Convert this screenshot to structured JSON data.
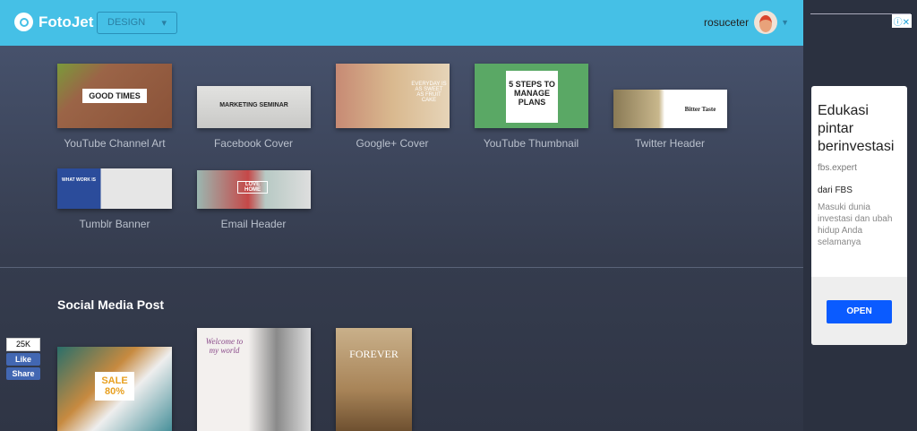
{
  "header": {
    "logo": "FotoJet",
    "mode": "DESIGN",
    "username": "rosuceter"
  },
  "templates": [
    {
      "label": "YouTube Channel Art",
      "text": "GOOD TIMES"
    },
    {
      "label": "Facebook Cover",
      "text": "MARKETING SEMINAR"
    },
    {
      "label": "Google+ Cover",
      "text": "EVERYDAY IS AS SWEET AS FRUIT CAKE"
    },
    {
      "label": "YouTube Thumbnail",
      "text": "5 STEPS TO MANAGE PLANS"
    },
    {
      "label": "Twitter Header",
      "text": "Bitter Taste"
    },
    {
      "label": "Tumblr Banner",
      "text": "WHAT WORK IS"
    },
    {
      "label": "Email Header",
      "text": "LOVE HOME"
    }
  ],
  "social": {
    "title": "Social Media Post",
    "posts": [
      {
        "text": "SALE 80%"
      },
      {
        "text": "Welcome to my world"
      },
      {
        "text": "FOREVER"
      }
    ]
  },
  "facebook": {
    "count": "25K",
    "like": "Like",
    "share": "Share"
  },
  "ad": {
    "title": "Edukasi pintar berinvestasi",
    "source": "fbs.expert",
    "from": "dari FBS",
    "description": "Masuki dunia investasi dan ubah hidup Anda selamanya",
    "button": "OPEN",
    "icons": "ⓘ✕"
  }
}
